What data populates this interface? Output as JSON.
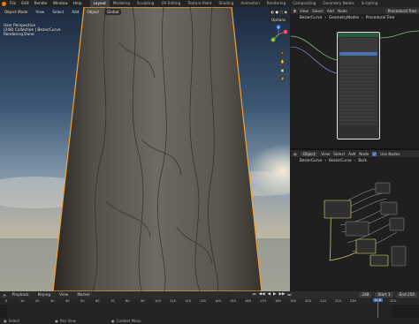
{
  "app": {
    "logo": "blender-logo"
  },
  "menu": [
    "File",
    "Edit",
    "Render",
    "Window",
    "Help"
  ],
  "workspace_tabs": [
    "Layout",
    "Modeling",
    "Sculpting",
    "UV Editing",
    "Texture Paint",
    "Shading",
    "Animation",
    "Rendering",
    "Compositing",
    "Geometry Nodes",
    "Scripting"
  ],
  "active_workspace": "Layout",
  "viewport": {
    "mode": "Object Mode",
    "header_menus": [
      "View",
      "Select",
      "Add",
      "Object"
    ],
    "orientation": "Global",
    "options_label": "Options",
    "overlay_lines": [
      "User Perspective",
      "(248) Collection | BezierCurve",
      "Rendering Done"
    ],
    "gizmo_axes": {
      "x": "X",
      "y": "Y",
      "z": "Z"
    }
  },
  "geo_editor": {
    "object": "Object",
    "menus": [
      "View",
      "Select",
      "Add",
      "Node"
    ],
    "tree_name": "Procedural Tree",
    "breadcrumb": [
      "BezierCurve",
      "GeometryNodes",
      "Procedural Tree"
    ]
  },
  "shader_editor": {
    "object": "Object",
    "menus": [
      "View",
      "Select",
      "Add",
      "Node"
    ],
    "use_nodes_label": "Use Nodes",
    "use_nodes_checked": true,
    "breadcrumb": [
      "BezierCurve",
      "BezierCurve",
      "Bark"
    ]
  },
  "timeline": {
    "menus": [
      "Playback",
      "Keying",
      "View",
      "Marker"
    ],
    "current_frame": "248",
    "start_label": "Start",
    "start": "1",
    "end_label": "End",
    "end": "250",
    "ticks": [
      "0",
      "10",
      "20",
      "30",
      "40",
      "50",
      "60",
      "70",
      "80",
      "90",
      "100",
      "110",
      "120",
      "130",
      "140",
      "150",
      "160",
      "170",
      "180",
      "190",
      "200",
      "210",
      "220",
      "230",
      "248",
      "250"
    ]
  },
  "status": [
    "Select",
    "Pan View",
    "Context Menu"
  ],
  "colors": {
    "accent": "#e87d0d",
    "selected_outline": "#f0a030",
    "node_frame": "#e0e0e0",
    "playhead": "#4772b3"
  }
}
